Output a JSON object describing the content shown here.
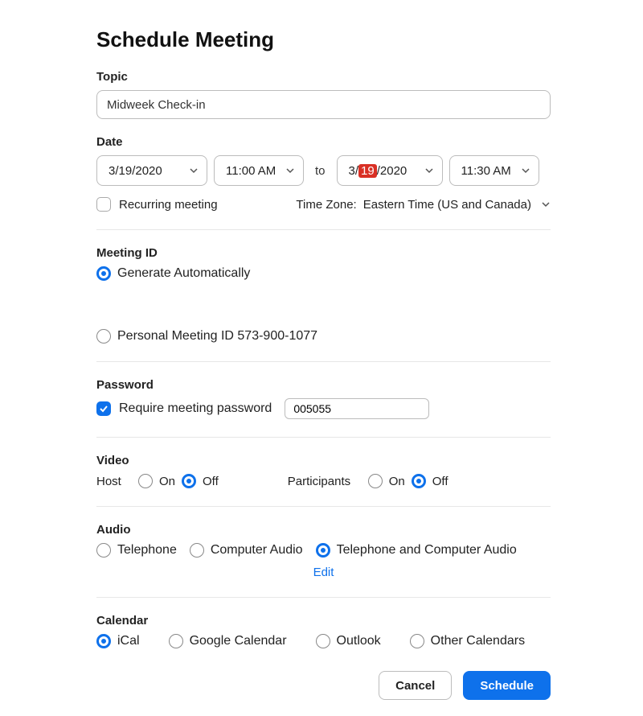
{
  "title": "Schedule Meeting",
  "topic": {
    "label": "Topic",
    "value": "Midweek Check-in"
  },
  "date": {
    "label": "Date",
    "start_date_prefix": "3/19/2020",
    "start_time": "11:00 AM",
    "to_label": "to",
    "end_date_prefix": "3/",
    "end_date_highlight": "19",
    "end_date_suffix": "/2020",
    "end_time": "11:30 AM",
    "recurring_label": "Recurring meeting",
    "recurring_checked": false,
    "timezone_label": "Time Zone:",
    "timezone_value": "Eastern Time (US and Canada)"
  },
  "meeting_id": {
    "label": "Meeting ID",
    "options": [
      {
        "label": "Generate Automatically",
        "selected": true
      },
      {
        "label": "Personal Meeting ID 573-900-1077",
        "selected": false
      }
    ]
  },
  "password": {
    "label": "Password",
    "require_label": "Require meeting password",
    "require_checked": true,
    "value": "005055"
  },
  "video": {
    "label": "Video",
    "host_label": "Host",
    "participants_label": "Participants",
    "on_label": "On",
    "off_label": "Off",
    "host_selected": "Off",
    "participants_selected": "Off"
  },
  "audio": {
    "label": "Audio",
    "options": [
      {
        "label": "Telephone",
        "selected": false
      },
      {
        "label": "Computer Audio",
        "selected": false
      },
      {
        "label": "Telephone and Computer Audio",
        "selected": true
      }
    ],
    "edit_label": "Edit"
  },
  "calendar": {
    "label": "Calendar",
    "options": [
      {
        "label": "iCal",
        "selected": true
      },
      {
        "label": "Google Calendar",
        "selected": false
      },
      {
        "label": "Outlook",
        "selected": false
      },
      {
        "label": "Other Calendars",
        "selected": false
      }
    ]
  },
  "footer": {
    "cancel": "Cancel",
    "schedule": "Schedule"
  }
}
